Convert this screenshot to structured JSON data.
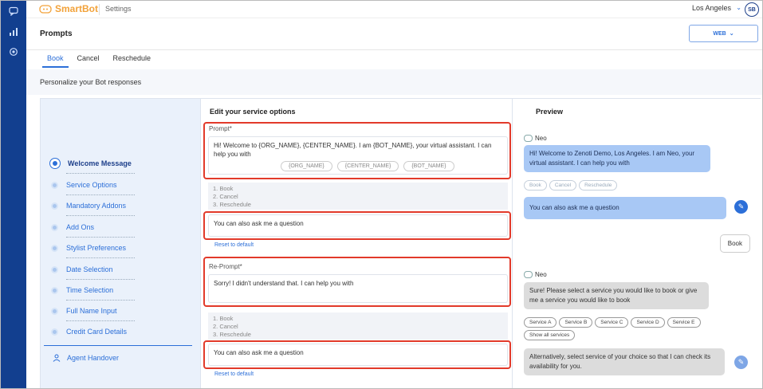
{
  "topbar": {
    "brand": "SmartBot",
    "settings": "Settings",
    "location": "Los Angeles",
    "avatar_initials": "SB"
  },
  "header": {
    "title": "Prompts",
    "channel": "WEB"
  },
  "tabs": [
    {
      "label": "Book",
      "active": true
    },
    {
      "label": "Cancel",
      "active": false
    },
    {
      "label": "Reschedule",
      "active": false
    }
  ],
  "subtitle": "Personalize your Bot responses",
  "steps": {
    "items": [
      {
        "label": "Welcome Message",
        "active": true
      },
      {
        "label": "Service Options"
      },
      {
        "label": "Mandatory Addons"
      },
      {
        "label": "Add Ons"
      },
      {
        "label": "Stylist Preferences"
      },
      {
        "label": "Date Selection"
      },
      {
        "label": "Time Selection"
      },
      {
        "label": "Full Name Input"
      },
      {
        "label": "Credit Card Details"
      }
    ],
    "handover": "Agent Handover"
  },
  "editor": {
    "title": "Edit your service options",
    "prompt_label": "Prompt*",
    "prompt_text": "Hi! Welcome to {ORG_NAME}, {CENTER_NAME}. I am {BOT_NAME}, your virtual assistant. I can help you with",
    "placeholders": [
      "{ORG_NAME}",
      "{CENTER_NAME}",
      "{BOT_NAME}"
    ],
    "options": [
      "1. Book",
      "2. Cancel",
      "3. Reschedule"
    ],
    "ask_text": "You can also ask me a question",
    "reset": "Reset to default",
    "reprompt_label": "Re-Prompt*",
    "reprompt_text": "Sorry! I didn't understand that. I can help you with",
    "options2": [
      "1. Book",
      "2. Cancel",
      "3. Reschedule"
    ],
    "ask_text2": "You can also ask me a question",
    "reset2": "Reset to default"
  },
  "preview": {
    "title": "Preview",
    "bot_name": "Neo",
    "welcome": "Hi! Welcome to Zenoti Demo, Los Angeles. I am Neo, your virtual assistant. I can help you with",
    "quick_options": [
      "Book",
      "Cancel",
      "Reschedule"
    ],
    "ask": "You can also ask me a question",
    "user_reply": "Book",
    "bot_name2": "Neo",
    "service_prompt": "Sure! Please select a service you would like to book or give me a service you would like to book",
    "services": [
      "Service A",
      "Service B",
      "Service C",
      "Service D",
      "Service E"
    ],
    "show_all": "Show all services",
    "alt_text": "Alternatively, select service of your choice so that I can check its availability for you."
  },
  "colors": {
    "rail": "#123f8f",
    "accent": "#2c6fd8",
    "highlight": "#e23a2a",
    "brand": "#f2a23a"
  }
}
